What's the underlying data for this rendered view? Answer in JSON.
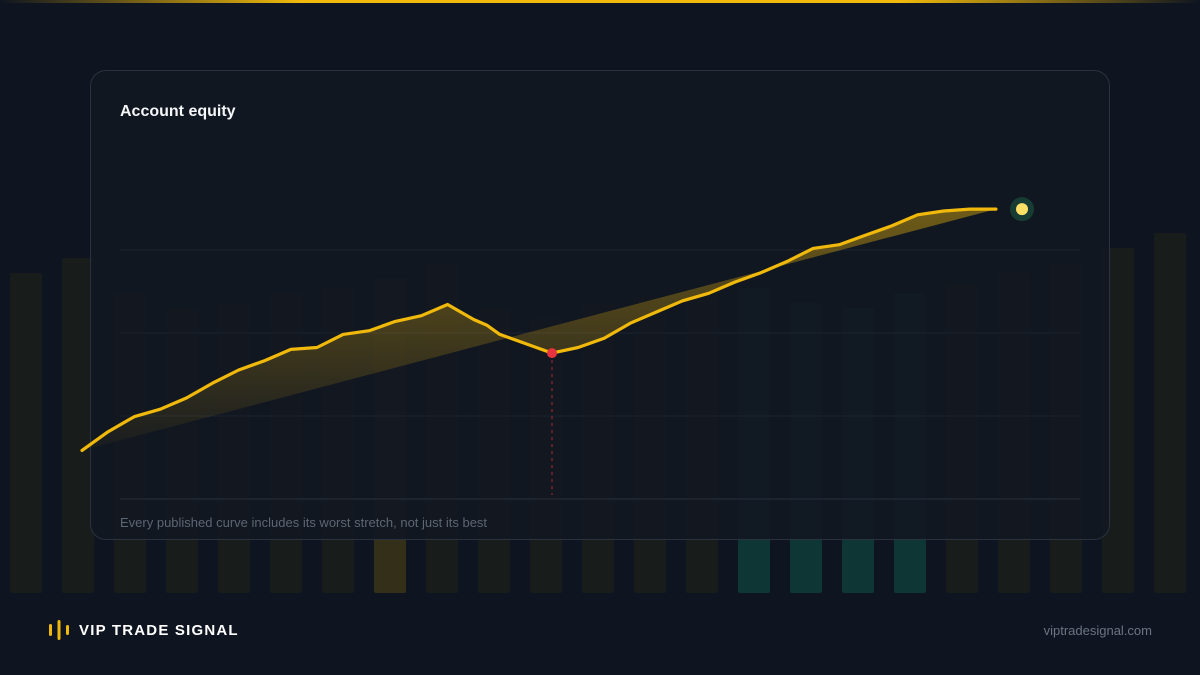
{
  "brand": {
    "name": "VIP TRADE SIGNAL",
    "url": "viptradesignal.com",
    "accent": "#f0b90b"
  },
  "card": {
    "title": "Account equity",
    "caption": "Every published curve includes its worst stretch, not just its best"
  },
  "colors": {
    "line": "#f0b90b",
    "drawdown_marker": "#e5343f",
    "end_marker": "#ffe066",
    "background": "#0f1520"
  },
  "chart_data": {
    "type": "area",
    "title": "Account equity",
    "xlabel": "",
    "ylabel": "",
    "grid": true,
    "axes_labels_shown": false,
    "ylim": [
      0,
      100
    ],
    "x": [
      0,
      1,
      2,
      3,
      4,
      5,
      6,
      7,
      8,
      9,
      10,
      11,
      12,
      13,
      14,
      15,
      15.5,
      16,
      17,
      18,
      19,
      20,
      21,
      22,
      23,
      24,
      25,
      26,
      27,
      28,
      29,
      30,
      31,
      32,
      33,
      34,
      35,
      36
    ],
    "y": [
      13,
      18,
      22,
      24,
      27,
      31,
      34.5,
      37,
      40,
      40.5,
      44,
      45,
      47.5,
      49,
      52,
      48,
      46.5,
      44,
      41.5,
      39,
      40.5,
      43,
      47,
      50,
      53,
      55,
      58,
      60.5,
      63.5,
      67,
      68,
      70.5,
      73,
      76,
      77,
      77.5,
      77.5
    ],
    "series": [
      {
        "values": [
          13,
          18,
          22,
          24,
          27,
          31,
          34.5,
          37,
          40,
          40.5,
          44,
          45,
          47.5,
          49,
          52,
          48,
          46.5,
          44,
          41.5,
          39,
          40.5,
          43,
          47,
          50,
          53,
          55,
          58,
          60.5,
          63.5,
          67,
          68,
          70.5,
          73,
          76,
          77,
          77.5,
          77.5
        ]
      }
    ],
    "annotations": [
      {
        "type": "max-drawdown-point",
        "x": 18,
        "y": 39
      },
      {
        "type": "latest-point",
        "x": 36,
        "y": 77.5
      }
    ]
  }
}
